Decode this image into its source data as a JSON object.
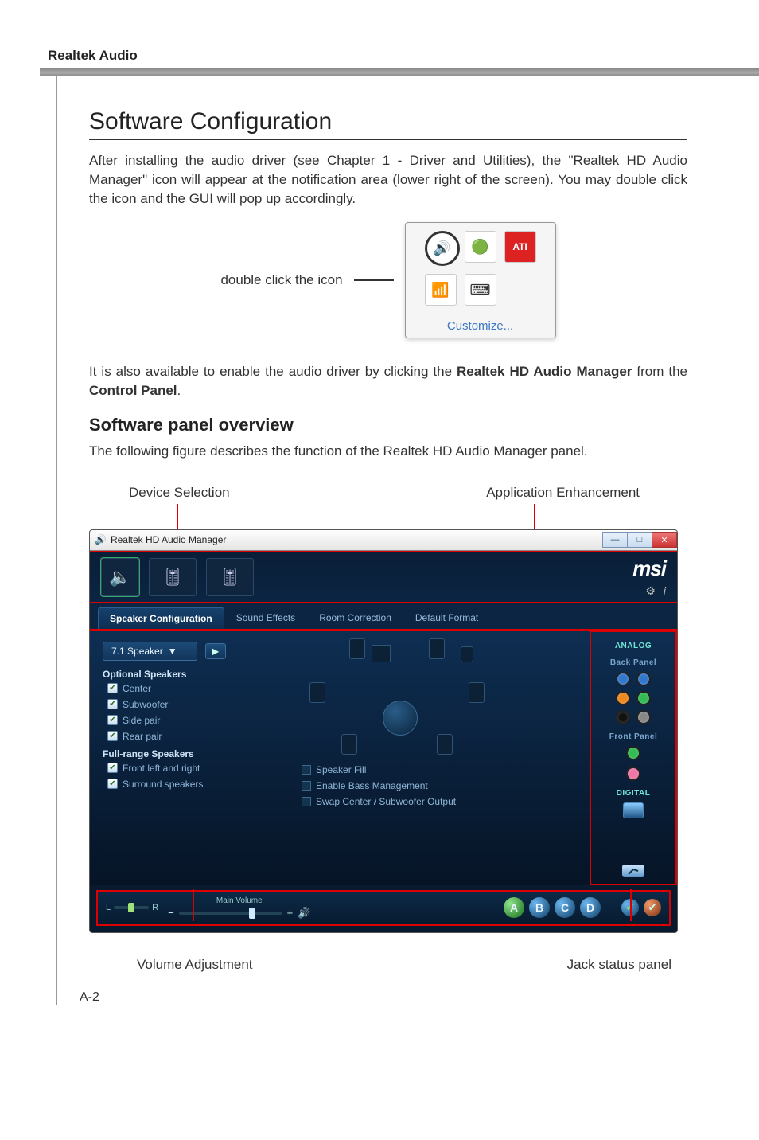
{
  "header": {
    "product": "Realtek Audio"
  },
  "section": {
    "title": "Software Configuration",
    "intro": "After installing the audio driver (see Chapter 1 - Driver and Utilities), the \"Realtek HD Audio Manager\" icon will appear at the notification area (lower right of the screen). You may double click the icon and the GUI will pop up accordingly.",
    "double_click_label": "double click the icon",
    "tray": {
      "customize": "Customize..."
    },
    "enable_text_pre": "It is also available to enable the audio driver by clicking the ",
    "enable_text_bold1": "Realtek HD Audio Manager",
    "enable_text_mid": " from the ",
    "enable_text_bold2": "Control Panel",
    "enable_text_post": "."
  },
  "overview": {
    "title": "Software panel overview",
    "desc": "The following figure describes the function of the Realtek HD Audio Manager panel.",
    "callout_device": "Device Selection",
    "callout_app": "Application Enhancement",
    "callout_volume": "Volume Adjustment",
    "callout_jack": "Jack status panel"
  },
  "app": {
    "title": "Realtek HD Audio Manager",
    "brand": "msi",
    "tabs": [
      "Speaker Configuration",
      "Sound Effects",
      "Room Correction",
      "Default Format"
    ],
    "speaker_mode": "7.1 Speaker",
    "group_optional": "Optional Speakers",
    "optional": [
      "Center",
      "Subwoofer",
      "Side pair",
      "Rear pair"
    ],
    "group_fullrange": "Full-range Speakers",
    "fullrange": [
      "Front left and right",
      "Surround speakers"
    ],
    "center_opts": [
      "Speaker Fill",
      "Enable Bass Management",
      "Swap Center / Subwoofer Output"
    ],
    "right": {
      "analog": "ANALOG",
      "back": "Back Panel",
      "front": "Front Panel",
      "digital": "DIGITAL"
    },
    "bottom": {
      "main_volume": "Main Volume",
      "L": "L",
      "R": "R",
      "badges": [
        "A",
        "B",
        "C",
        "D"
      ]
    }
  },
  "footer": {
    "page": "A-2"
  }
}
